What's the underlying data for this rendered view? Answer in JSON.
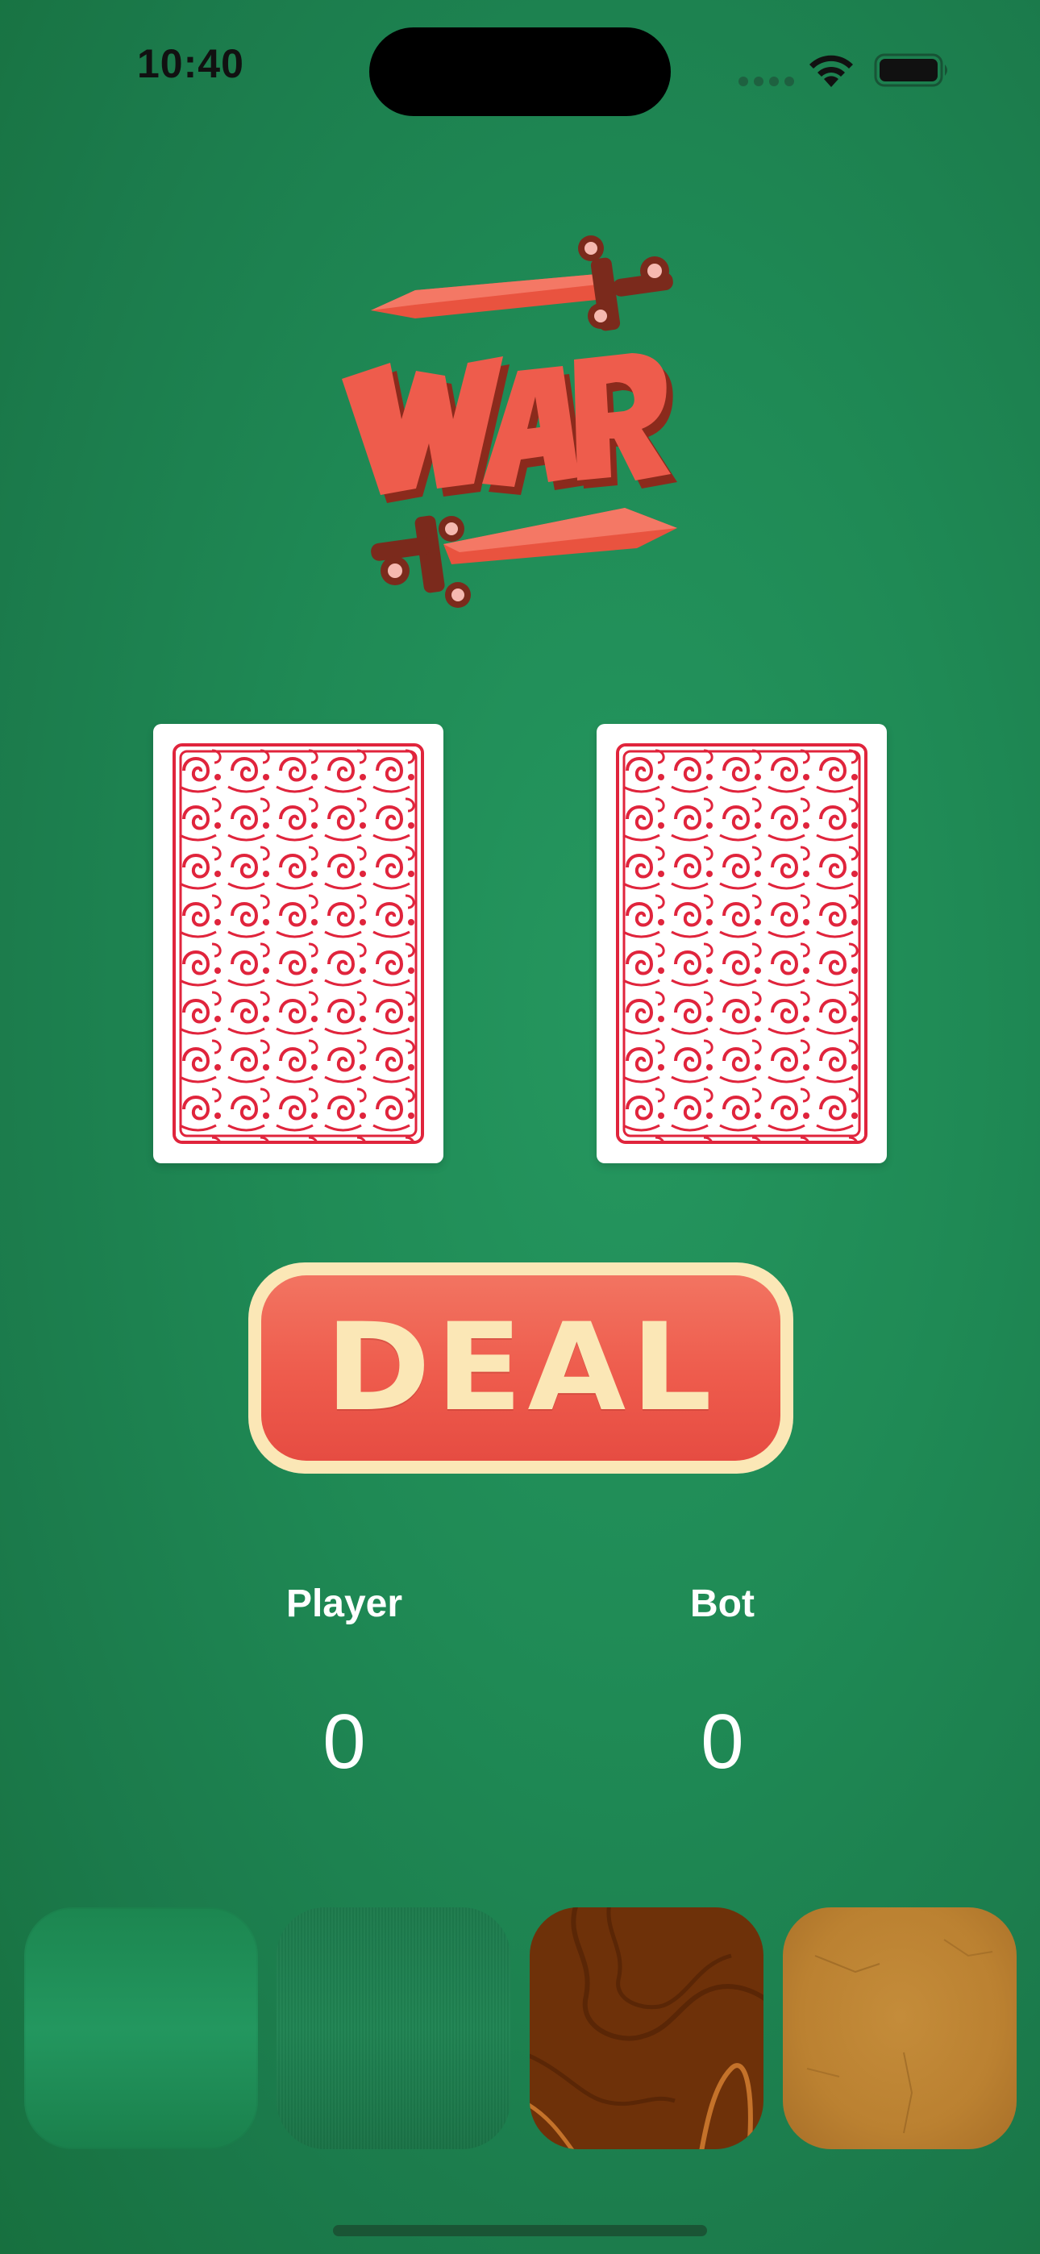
{
  "status_bar": {
    "time": "10:40"
  },
  "logo": {
    "text": "WAR",
    "colors": {
      "blade": "#ee5c4c",
      "hilt": "#7b2a1c",
      "pommel": "#f6b8b0"
    }
  },
  "cards": {
    "left": {
      "state": "face-down",
      "back_color": "#e0243c"
    },
    "right": {
      "state": "face-down",
      "back_color": "#e0243c"
    }
  },
  "deal_button": {
    "label": "DEAL",
    "colors": {
      "fill": "#ee5b4c",
      "border": "#fbe7b6"
    }
  },
  "scores": {
    "player_label": "Player",
    "player_score": "0",
    "bot_label": "Bot",
    "bot_score": "0"
  },
  "backgrounds": [
    {
      "name": "green-gradient",
      "color": "#23975f"
    },
    {
      "name": "green-felt",
      "color": "#1f8352"
    },
    {
      "name": "dark-wood",
      "color": "#6e3109"
    },
    {
      "name": "parchment",
      "color": "#c48c3a"
    }
  ]
}
